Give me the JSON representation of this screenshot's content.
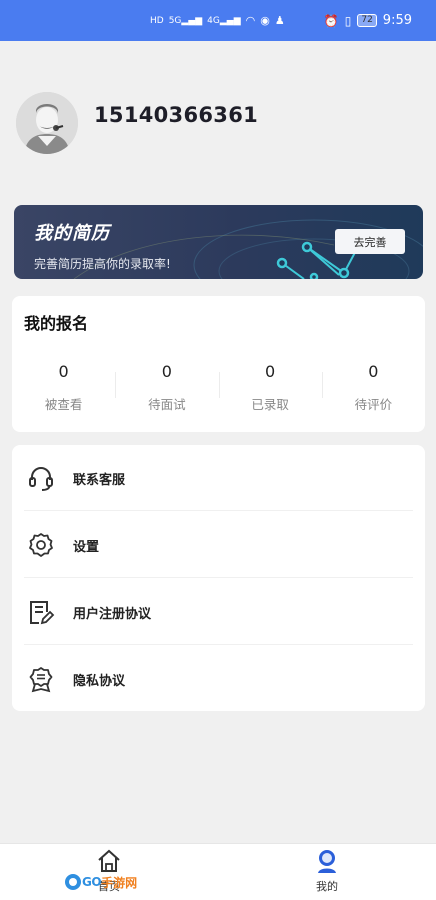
{
  "status_bar": {
    "time": "9:59",
    "battery": "72",
    "network_left": "HD",
    "signal_1": "5G",
    "signal_2": "4G"
  },
  "profile": {
    "phone": "15140366361"
  },
  "resume_banner": {
    "title": "我的简历",
    "subtitle": "完善简历提高你的录取率!",
    "button_label": "去完善"
  },
  "registration": {
    "title": "我的报名",
    "stats": [
      {
        "value": "0",
        "label": "被查看"
      },
      {
        "value": "0",
        "label": "待面试"
      },
      {
        "value": "0",
        "label": "已录取"
      },
      {
        "value": "0",
        "label": "待评价"
      }
    ]
  },
  "menu": {
    "items": [
      {
        "label": "联系客服",
        "icon": "headset-icon"
      },
      {
        "label": "设置",
        "icon": "gear-icon"
      },
      {
        "label": "用户注册协议",
        "icon": "document-edit-icon"
      },
      {
        "label": "隐私协议",
        "icon": "privacy-badge-icon"
      }
    ]
  },
  "bottom_nav": {
    "home_label": "首页",
    "mine_label": "我的",
    "watermark_text_1": "GO",
    "watermark_text_2": "手游网"
  },
  "colors": {
    "status_bar": "#4a7cf0",
    "banner_dark": "#2c3a5c",
    "active_nav": "#2b5fd9"
  }
}
